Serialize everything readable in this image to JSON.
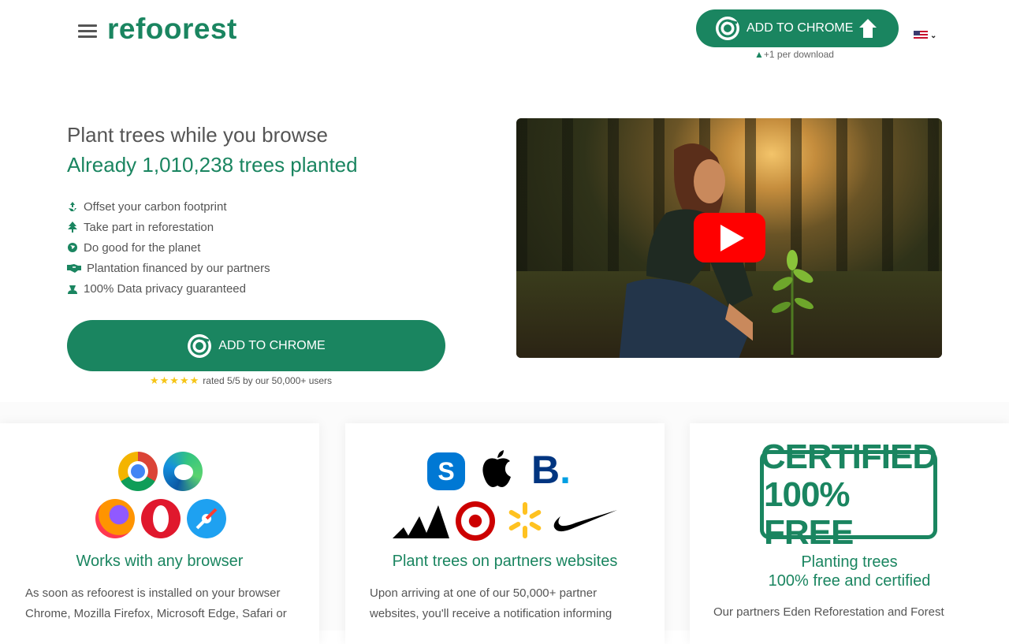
{
  "header": {
    "logo": "refoorest",
    "cta_label": "ADD TO CHROME",
    "per_download": "+1 per download"
  },
  "hero": {
    "title": "Plant trees while you browse",
    "subtitle": "Already 1,010,238 trees planted",
    "features": [
      {
        "icon": "recycle-icon",
        "text": "Offset your carbon footprint"
      },
      {
        "icon": "tree-icon",
        "text": "Take part in reforestation"
      },
      {
        "icon": "globe-icon",
        "text": "Do good for the planet"
      },
      {
        "icon": "handshake-icon",
        "text": "Plantation financed by our partners"
      },
      {
        "icon": "user-secret-icon",
        "text": "100% Data privacy guaranteed"
      }
    ],
    "cta_label": "ADD TO CHROME",
    "rating_stars": "★★★★★",
    "rating_text": "rated 5/5 by our 50,000+ users"
  },
  "cards": [
    {
      "title": "Works with any browser",
      "text": "As soon as refoorest is installed on your browser Chrome, Mozilla Firefox, Microsoft Edge, Safari or"
    },
    {
      "title": "Plant trees on partners websites",
      "text": "Upon arriving at one of our 50,000+ partner websites, you'll receive a notification informing"
    },
    {
      "title_line1": "Planting trees",
      "title_line2": "100% free and certified",
      "stamp_line1": "CERTIFIED",
      "stamp_line2": "100% FREE",
      "text": "Our partners Eden Reforestation and Forest"
    }
  ],
  "colors": {
    "brand": "#1a8560",
    "text": "#555555",
    "play": "#ff0000",
    "star": "#f5c518"
  }
}
